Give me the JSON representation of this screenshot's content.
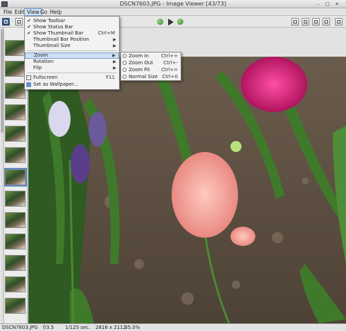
{
  "window": {
    "title": "DSCN7603.JPG - Image Viewer [43/73]"
  },
  "menubar": {
    "items": [
      "File",
      "Edit",
      "View",
      "Go",
      "Help"
    ]
  },
  "toolbar": {
    "icons": [
      "view-icon",
      "open-icon",
      "previous-icon",
      "next-icon",
      "slideshow-icon",
      "zoom-in-icon",
      "zoom-out-icon",
      "zoom-fit-icon",
      "normal-size-icon",
      "fullscreen-icon"
    ]
  },
  "view_menu": {
    "items": [
      {
        "label": "Show Toolbar",
        "checked": true,
        "accel": ""
      },
      {
        "label": "Show Status Bar",
        "checked": true,
        "accel": ""
      },
      {
        "label": "Show Thumbnail Bar",
        "checked": true,
        "accel": "Ctrl+M"
      },
      {
        "label": "Thumbnail Bar Position",
        "checked": false,
        "accel": "",
        "submenu": true
      },
      {
        "label": "Thumbnail Size",
        "checked": false,
        "accel": "",
        "submenu": true
      },
      {
        "label": "Zoom",
        "checked": false,
        "accel": "",
        "submenu": true,
        "highlighted": true
      },
      {
        "label": "Rotation",
        "checked": false,
        "accel": "",
        "submenu": true
      },
      {
        "label": "Flip",
        "checked": false,
        "accel": "",
        "submenu": true
      },
      {
        "label": "Fullscreen",
        "checked": false,
        "accel": "F11"
      },
      {
        "label": "Set as Wallpaper...",
        "checked": false,
        "accel": ""
      }
    ]
  },
  "zoom_submenu": {
    "items": [
      {
        "label": "Zoom In",
        "accel": "Ctrl++"
      },
      {
        "label": "Zoom Out",
        "accel": "Ctrl+-"
      },
      {
        "label": "Zoom Fit",
        "accel": "Ctrl+="
      },
      {
        "label": "Normal Size",
        "accel": "Ctrl+0"
      }
    ]
  },
  "statusbar": {
    "filename": "DSCN7603.JPG",
    "aperture": "f/3.5",
    "exposure": "1/125 sec.",
    "dimensions": "2816 x 2112",
    "zoom": "35.0%"
  },
  "colors": {
    "accent": "#5d8ac7",
    "highlight": "#cfe0f4",
    "menu_bg": "#f2f2f2"
  }
}
